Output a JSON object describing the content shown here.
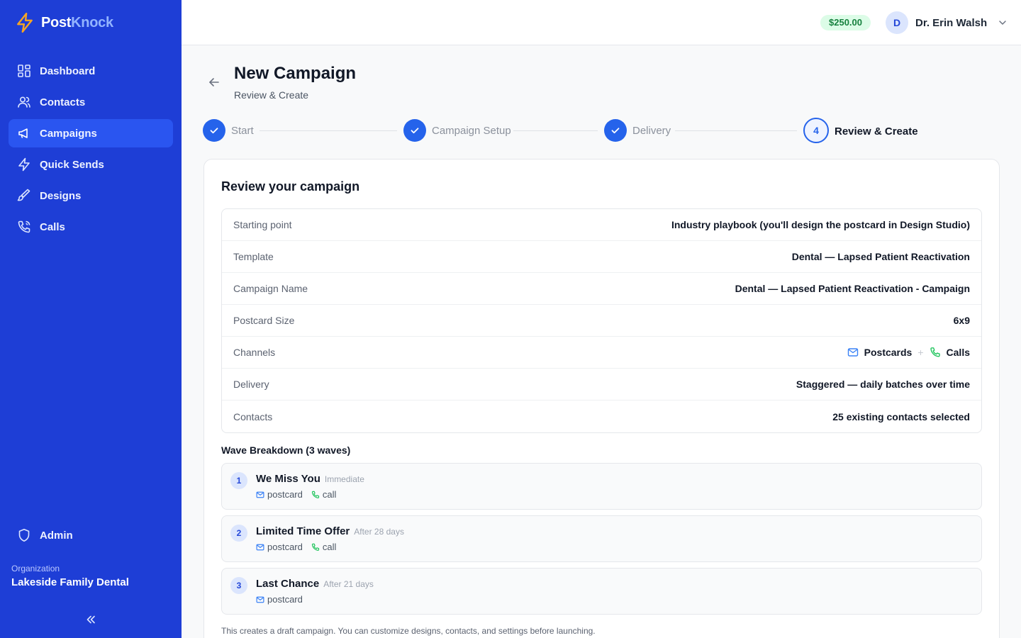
{
  "brand": {
    "name_part1": "Post",
    "name_part2": "Knock"
  },
  "sidebar": {
    "items": [
      {
        "label": "Dashboard",
        "icon": "dashboard-icon"
      },
      {
        "label": "Contacts",
        "icon": "users-icon"
      },
      {
        "label": "Campaigns",
        "icon": "megaphone-icon",
        "active": true
      },
      {
        "label": "Quick Sends",
        "icon": "bolt-icon"
      },
      {
        "label": "Designs",
        "icon": "brush-icon"
      },
      {
        "label": "Calls",
        "icon": "phone-icon"
      }
    ],
    "admin_label": "Admin",
    "org_label": "Organization",
    "org_name": "Lakeside Family Dental"
  },
  "header": {
    "balance": "$250.00",
    "user_initial": "D",
    "user_name": "Dr. Erin Walsh"
  },
  "page": {
    "title": "New Campaign",
    "subtitle": "Review & Create"
  },
  "steps": [
    {
      "label": "Start",
      "status": "complete"
    },
    {
      "label": "Campaign Setup",
      "status": "complete"
    },
    {
      "label": "Delivery",
      "status": "complete"
    },
    {
      "label": "Review & Create",
      "number": "4",
      "status": "current"
    }
  ],
  "review": {
    "title": "Review your campaign",
    "rows": [
      {
        "key": "Starting point",
        "value": "Industry playbook (you'll design the postcard in Design Studio)"
      },
      {
        "key": "Template",
        "value": "Dental — Lapsed Patient Reactivation"
      },
      {
        "key": "Campaign Name",
        "value": "Dental — Lapsed Patient Reactivation - Campaign"
      },
      {
        "key": "Postcard Size",
        "value": "6x9"
      },
      {
        "key": "Channels",
        "channels": [
          "Postcards",
          "Calls"
        ],
        "separator": "+"
      },
      {
        "key": "Delivery",
        "value": "Staggered — daily batches over time"
      },
      {
        "key": "Contacts",
        "value": "25 existing contacts selected"
      }
    ]
  },
  "waves": {
    "title": "Wave Breakdown (3 waves)",
    "items": [
      {
        "number": "1",
        "name": "We Miss You",
        "timing": "Immediate",
        "channels": [
          "postcard",
          "call"
        ]
      },
      {
        "number": "2",
        "name": "Limited Time Offer",
        "timing": "After 28 days",
        "channels": [
          "postcard",
          "call"
        ]
      },
      {
        "number": "3",
        "name": "Last Chance",
        "timing": "After 21 days",
        "channels": [
          "postcard"
        ]
      }
    ]
  },
  "footnote": "This creates a draft campaign. You can customize designs, contacts, and settings before launching.",
  "colors": {
    "sidebar": "#1e3ed6",
    "accent": "#2563eb",
    "balance_bg": "#dcfce7",
    "balance_text": "#15803d",
    "postcard_icon": "#3b82f6",
    "call_icon": "#22c55e"
  }
}
